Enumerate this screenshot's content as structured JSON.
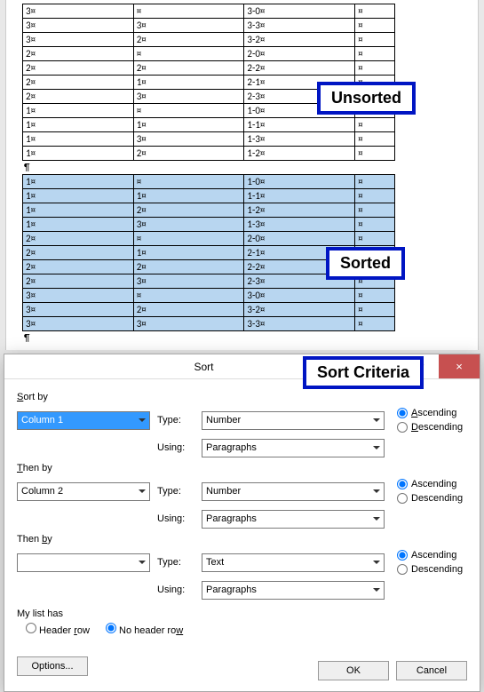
{
  "callouts": {
    "unsorted": "Unsorted",
    "sorted": "Sorted",
    "criteria": "Sort Criteria"
  },
  "marks": {
    "cell": "¤",
    "para": "¶"
  },
  "unsorted_table": {
    "rows": [
      [
        "3",
        "",
        "3-0",
        ""
      ],
      [
        "3",
        "3",
        "3-3",
        ""
      ],
      [
        "3",
        "2",
        "3-2",
        ""
      ],
      [
        "2",
        "",
        "2-0",
        ""
      ],
      [
        "2",
        "2",
        "2-2",
        ""
      ],
      [
        "2",
        "1",
        "2-1",
        ""
      ],
      [
        "2",
        "3",
        "2-3",
        ""
      ],
      [
        "1",
        "",
        "1-0",
        ""
      ],
      [
        "1",
        "1",
        "1-1",
        ""
      ],
      [
        "1",
        "3",
        "1-3",
        ""
      ],
      [
        "1",
        "2",
        "1-2",
        ""
      ]
    ]
  },
  "sorted_table": {
    "rows": [
      [
        "1",
        "",
        "1-0",
        ""
      ],
      [
        "1",
        "1",
        "1-1",
        ""
      ],
      [
        "1",
        "2",
        "1-2",
        ""
      ],
      [
        "1",
        "3",
        "1-3",
        ""
      ],
      [
        "2",
        "",
        "2-0",
        ""
      ],
      [
        "2",
        "1",
        "2-1",
        ""
      ],
      [
        "2",
        "2",
        "2-2",
        ""
      ],
      [
        "2",
        "3",
        "2-3",
        ""
      ],
      [
        "3",
        "",
        "3-0",
        ""
      ],
      [
        "3",
        "2",
        "3-2",
        ""
      ],
      [
        "3",
        "3",
        "3-3",
        ""
      ]
    ]
  },
  "dialog": {
    "title": "Sort",
    "help": "?",
    "close": "×",
    "sort_by_label": "Sort by",
    "then_by_label": "Then by",
    "type_label": "Type:",
    "using_label": "Using:",
    "ascending": "Ascending",
    "descending": "Descending",
    "levels": [
      {
        "field": "Column 1",
        "type": "Number",
        "using": "Paragraphs",
        "order": "asc",
        "highlight": true
      },
      {
        "field": "Column 2",
        "type": "Number",
        "using": "Paragraphs",
        "order": "asc",
        "highlight": false
      },
      {
        "field": "",
        "type": "Text",
        "using": "Paragraphs",
        "order": "asc",
        "highlight": false
      }
    ],
    "my_list_label": "My list has",
    "header_row": "Header row",
    "no_header_row": "No header row",
    "header_selected": "no_header",
    "options": "Options...",
    "ok": "OK",
    "cancel": "Cancel"
  }
}
